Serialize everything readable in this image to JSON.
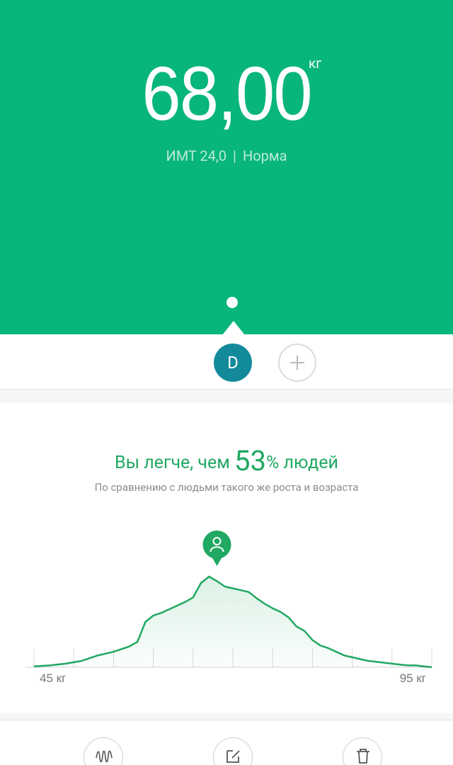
{
  "measurement": {
    "weight": "68,00",
    "unit": "кг",
    "bmi_label": "ИМТ 24,0",
    "bmi_status": "Норма"
  },
  "users": {
    "current_initial": "D"
  },
  "comparison": {
    "prefix": "Вы легче, чем",
    "percent": "53",
    "suffix": "% людей",
    "subtitle": "По сравнению с людьми такого же роста и возраста"
  },
  "chart_data": {
    "type": "area",
    "x_min_label": "45 кг",
    "x_max_label": "95 кг",
    "xlim": [
      45,
      95
    ],
    "marker_x": 68,
    "x": [
      45,
      47,
      49,
      51,
      53,
      55,
      57,
      58,
      59,
      60,
      61,
      62,
      63,
      64,
      65,
      66,
      67,
      68,
      69,
      70,
      71,
      72,
      73,
      74,
      75,
      76,
      77,
      78,
      79,
      80,
      81,
      82,
      83,
      84,
      85,
      86,
      87,
      88,
      89,
      90,
      91,
      92,
      93,
      94,
      95
    ],
    "y": [
      0.01,
      0.02,
      0.04,
      0.07,
      0.13,
      0.17,
      0.23,
      0.28,
      0.5,
      0.57,
      0.6,
      0.64,
      0.68,
      0.72,
      0.77,
      0.93,
      1.0,
      0.95,
      0.89,
      0.87,
      0.85,
      0.83,
      0.76,
      0.7,
      0.65,
      0.61,
      0.55,
      0.45,
      0.4,
      0.3,
      0.24,
      0.21,
      0.17,
      0.13,
      0.11,
      0.09,
      0.07,
      0.06,
      0.05,
      0.04,
      0.03,
      0.02,
      0.02,
      0.01,
      0.0
    ]
  },
  "toolbar": {
    "icons": [
      "waveform-icon",
      "edit-icon",
      "delete-icon"
    ]
  },
  "colors": {
    "hero": "#08b57a",
    "accent": "#21a862",
    "avatar": "#128a9a"
  }
}
